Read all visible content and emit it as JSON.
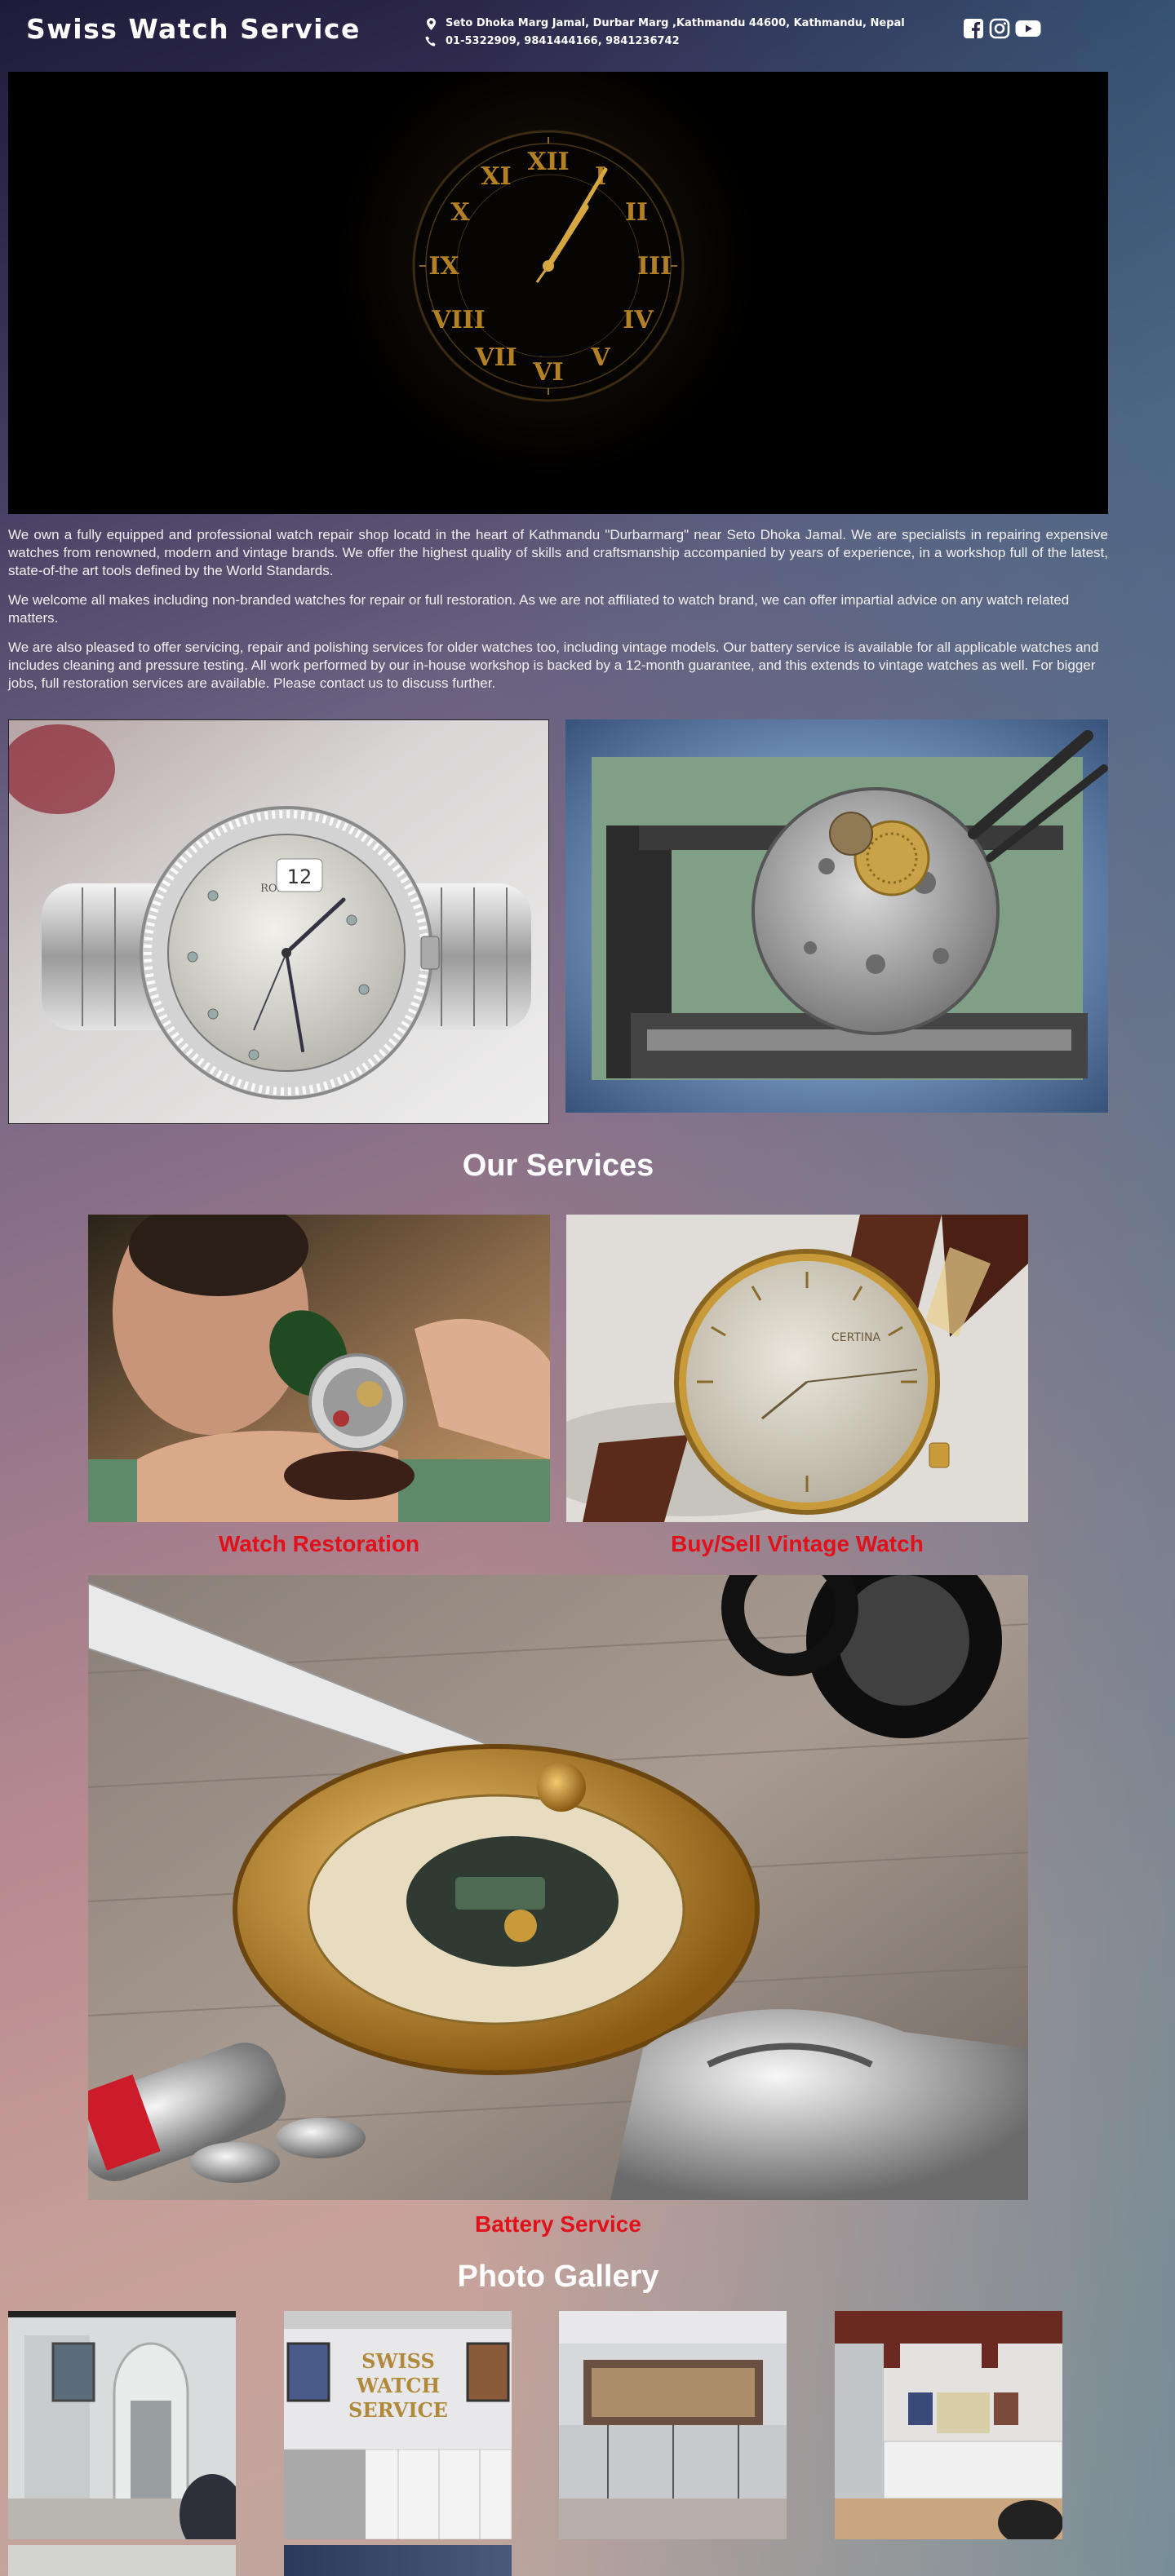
{
  "header": {
    "brand": "Swiss Watch Service",
    "address": "Seto Dhoka Marg Jamal, Durbar Marg ,Kathmandu 44600, Kathmandu, Nepal",
    "phone": "01-5322909, 9841444166, 9841236742",
    "icons": [
      "map-marker-icon",
      "phone-icon",
      "facebook-icon",
      "instagram-icon",
      "youtube-icon"
    ]
  },
  "intro": {
    "p1": "We own a fully equipped and professional watch repair shop locatd in the heart of Kathmandu \"Durbarmarg\" near Seto Dhoka Jamal. We are specialists in repairing expensive watches from renowned, modern and vintage brands. We offer the highest quality of skills and craftsmanship accompanied by years of experience, in a workshop full of the latest, state-of-the art tools defined by the World Standards.",
    "p2": "We welcome all makes including non-branded watches for repair or full restoration. As we are not affiliated to watch brand, we can offer impartial advice on any watch related matters.",
    "p3": "We are also pleased to offer servicing, repair and polishing services for older watches too, including vintage models. Our battery service is available for all applicable watches and includes cleaning and pressure testing. All work performed by our in-house workshop is backed by a 12-month guarantee, and this extends to vintage watches as well. For bigger jobs, full restoration services are available. Please contact us to discuss further."
  },
  "services": {
    "title": "Our Services",
    "items": [
      {
        "label": "Watch Restoration"
      },
      {
        "label": "Buy/Sell Vintage Watch"
      },
      {
        "label": "Battery Service"
      }
    ]
  },
  "gallery": {
    "title": "Photo Gallery"
  },
  "photo_texts": {
    "rolex_brand": "ROLEX",
    "rolex_date": "12",
    "certina": "CERTINA",
    "shop_sign": [
      "SWISS",
      "WATCH",
      "SERVICE"
    ]
  },
  "colors": {
    "accent": "#e0111b",
    "header_bg": "#1e1b3a"
  }
}
